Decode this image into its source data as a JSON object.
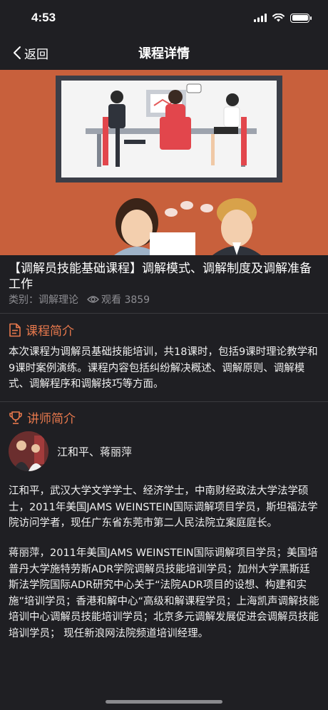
{
  "status_bar": {
    "time": "4:53"
  },
  "nav": {
    "back_label": "返回",
    "title": "课程详情"
  },
  "course": {
    "title": "【调解员技能基础课程】调解模式、调解制度及调解准备工作",
    "category": "类别：调解理论",
    "views": "观看 3859"
  },
  "intro": {
    "heading": "课程简介",
    "text": "本次课程为调解员基础技能培训，共18课时，包括9课时理论教学和9课时案例演练。课程内容包括纠纷解决概述、调解原则、调解模式、调解程序和调解技巧等方面。"
  },
  "teacher": {
    "heading": "讲师简介",
    "names": "江和平、蒋丽萍",
    "bio_1": "江和平，武汉大学文学学士、经济学士，中南财经政法大学法学硕士，2011年美国JAMS WEINSTEIN国际调解项目学员，斯坦福法学院访问学者，现任广东省东莞市第二人民法院立案庭庭长。",
    "bio_2": "蒋丽萍，2011年美国JAMS WEINSTEIN国际调解项目学员；美国培普丹大学施特劳斯ADR学院调解员技能培训学员；加州大学黑斯廷斯法学院国际ADR研究中心关于“法院ADR项目的设想、构建和实施”培训学员；香港和解中心“高级和解课程学员；上海凯声调解技能培训中心调解员技能培训学员；北京多元调解发展促进会调解员技能培训学员；  现任新浪网法院频道培训经理。"
  },
  "colors": {
    "accent": "#e8794d",
    "background": "#1f1f23",
    "hero": "#c8603c"
  }
}
